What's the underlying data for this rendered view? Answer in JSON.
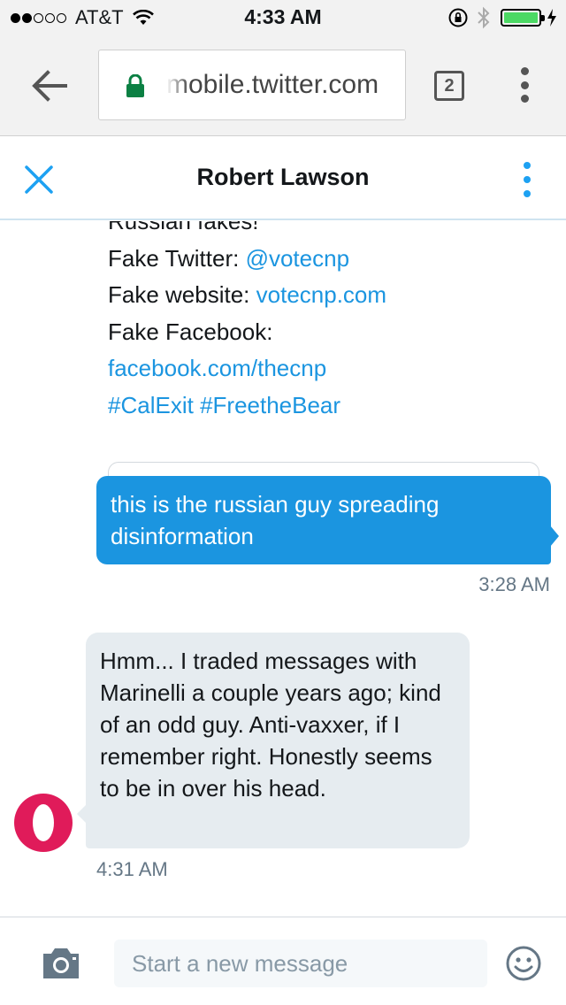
{
  "status_bar": {
    "carrier": "AT&T",
    "time": "4:33 AM",
    "signal_bars_filled": 2,
    "signal_bars_total": 5,
    "battery_level": 1.0
  },
  "browser": {
    "url": "mobile.twitter.com",
    "tab_count": "2"
  },
  "conversation": {
    "title": "Robert Lawson"
  },
  "quoted_tweet": {
    "line1": "Russian fakes!",
    "line2_prefix": "Fake Twitter: ",
    "line2_link": "@votecnp",
    "line3_prefix": "Fake website: ",
    "line3_link": "votecnp.com",
    "line4": "Fake Facebook:",
    "line5_link": "facebook.com/thecnp",
    "line6_tag1": "#CalExit",
    "line6_tag2": "#FreetheBear"
  },
  "messages": [
    {
      "direction": "outgoing",
      "text": "this is the russian guy spreading disinformation",
      "time": "3:28 AM"
    },
    {
      "direction": "incoming",
      "text": "Hmm... I traded messages with Marinelli a couple years ago; kind of an odd guy. Anti-vaxxer, if I remember right. Honestly seems to be in over his head.",
      "time": "4:31 AM"
    }
  ],
  "composer": {
    "placeholder": "Start a new message"
  },
  "icons": {
    "back": "back-arrow-icon",
    "lock": "lock-icon",
    "menu": "more-vertical-icon",
    "close": "close-icon",
    "camera": "camera-icon",
    "emoji": "emoji-icon",
    "wifi": "wifi-icon",
    "orientation_lock": "orientation-lock-icon",
    "bluetooth": "bluetooth-icon",
    "charging": "charging-bolt-icon"
  },
  "colors": {
    "twitter_blue": "#1b95e0",
    "incoming_bubble": "#e6ecf0",
    "avatar": "#e01b5a",
    "secure_lock": "#0b8043",
    "battery": "#4cd964"
  }
}
